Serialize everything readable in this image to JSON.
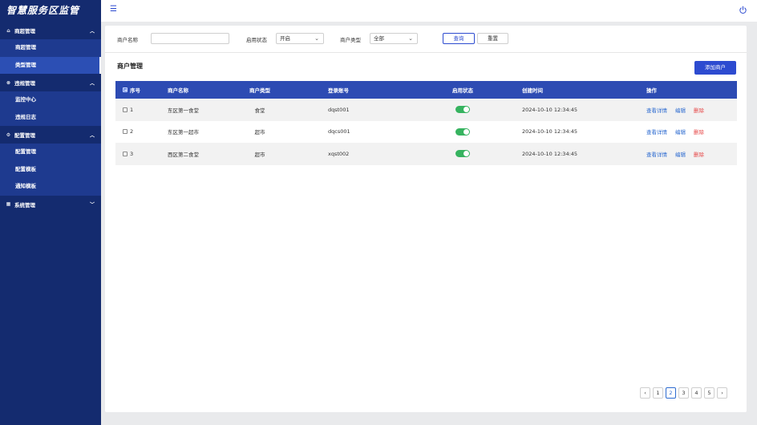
{
  "app": {
    "title": "智慧服务区监管"
  },
  "sidebar": {
    "groups": [
      {
        "label": "商超管理",
        "icon": "shop-icon",
        "items": [
          {
            "label": "商超管理"
          },
          {
            "label": "类型管理"
          }
        ]
      },
      {
        "label": "违规管理",
        "icon": "warning-icon",
        "items": [
          {
            "label": "监控中心"
          },
          {
            "label": "违规日志"
          }
        ]
      },
      {
        "label": "配置管理",
        "icon": "settings-icon",
        "items": [
          {
            "label": "配置管理"
          },
          {
            "label": "配置模板"
          },
          {
            "label": "通知模板"
          }
        ]
      },
      {
        "label": "系统管理",
        "icon": "system-icon",
        "items": []
      }
    ],
    "active_item": "类型管理"
  },
  "filter": {
    "name_label": "商户名称",
    "name_value": "",
    "status_label": "启用状态",
    "status_value": "开启",
    "type_label": "商户类型",
    "type_value": "全部",
    "query_label": "查询",
    "reset_label": "重置"
  },
  "section": {
    "title": "商户管理",
    "add_label": "添加商户"
  },
  "table": {
    "headers": {
      "seq": "序号",
      "name": "商户名称",
      "type": "商户类型",
      "account": "登录账号",
      "status": "启用状态",
      "created": "创建时间",
      "ops": "操作"
    },
    "rows": [
      {
        "seq": "1",
        "name": "东区第一食堂",
        "type": "食堂",
        "account": "dqst001",
        "enabled": true,
        "created": "2024-10-10 12:34:45"
      },
      {
        "seq": "2",
        "name": "东区第一超市",
        "type": "超市",
        "account": "dqcs001",
        "enabled": true,
        "created": "2024-10-10 12:34:45"
      },
      {
        "seq": "3",
        "name": "西区第二食堂",
        "type": "超市",
        "account": "xqst002",
        "enabled": true,
        "created": "2024-10-10 12:34:45"
      }
    ],
    "ops": {
      "view": "查看详情",
      "edit": "编辑",
      "delete": "删除"
    }
  },
  "pagination": {
    "prev": "‹",
    "next": "›",
    "pages": [
      "1",
      "2",
      "3",
      "4",
      "5"
    ],
    "current": "2"
  },
  "colors": {
    "sidebar_bg": "#142b6f",
    "accent": "#2d4bd0",
    "table_header": "#2d4bb3",
    "switch_on": "#36b35f",
    "danger": "#e64545"
  }
}
